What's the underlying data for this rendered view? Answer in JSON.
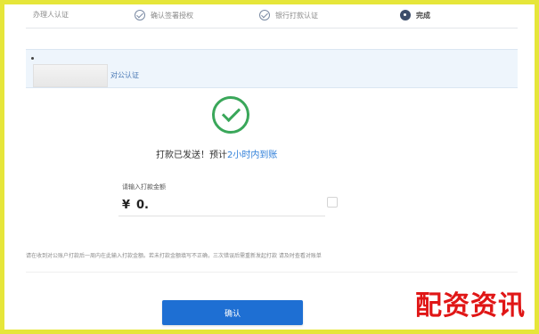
{
  "steps": [
    {
      "label": "办理人认证",
      "state": "done"
    },
    {
      "label": "确认签署授权",
      "state": "done"
    },
    {
      "label": "银行打款认证",
      "state": "done"
    },
    {
      "label": "完成",
      "state": "current"
    }
  ],
  "banner": {
    "label": "对公认证"
  },
  "result": {
    "message_prefix": "打款已发送！预计",
    "message_link": "2小时内到账",
    "status_color": "#3aa75a"
  },
  "amount": {
    "label": "请输入打款金额",
    "currency": "¥",
    "value": "0."
  },
  "note": {
    "text": "请在收到对公账户打款后一周内在此输入打款金额。若未打款金额填写不正确，三次错误后需重新发起打款 请及时查看对账单"
  },
  "actions": {
    "confirm_label": "确认"
  },
  "watermark": {
    "text": "配资资讯"
  },
  "colors": {
    "accent": "#1e6fd3",
    "success": "#3aa75a",
    "frame": "#e6e63a",
    "watermark": "#e01616"
  }
}
